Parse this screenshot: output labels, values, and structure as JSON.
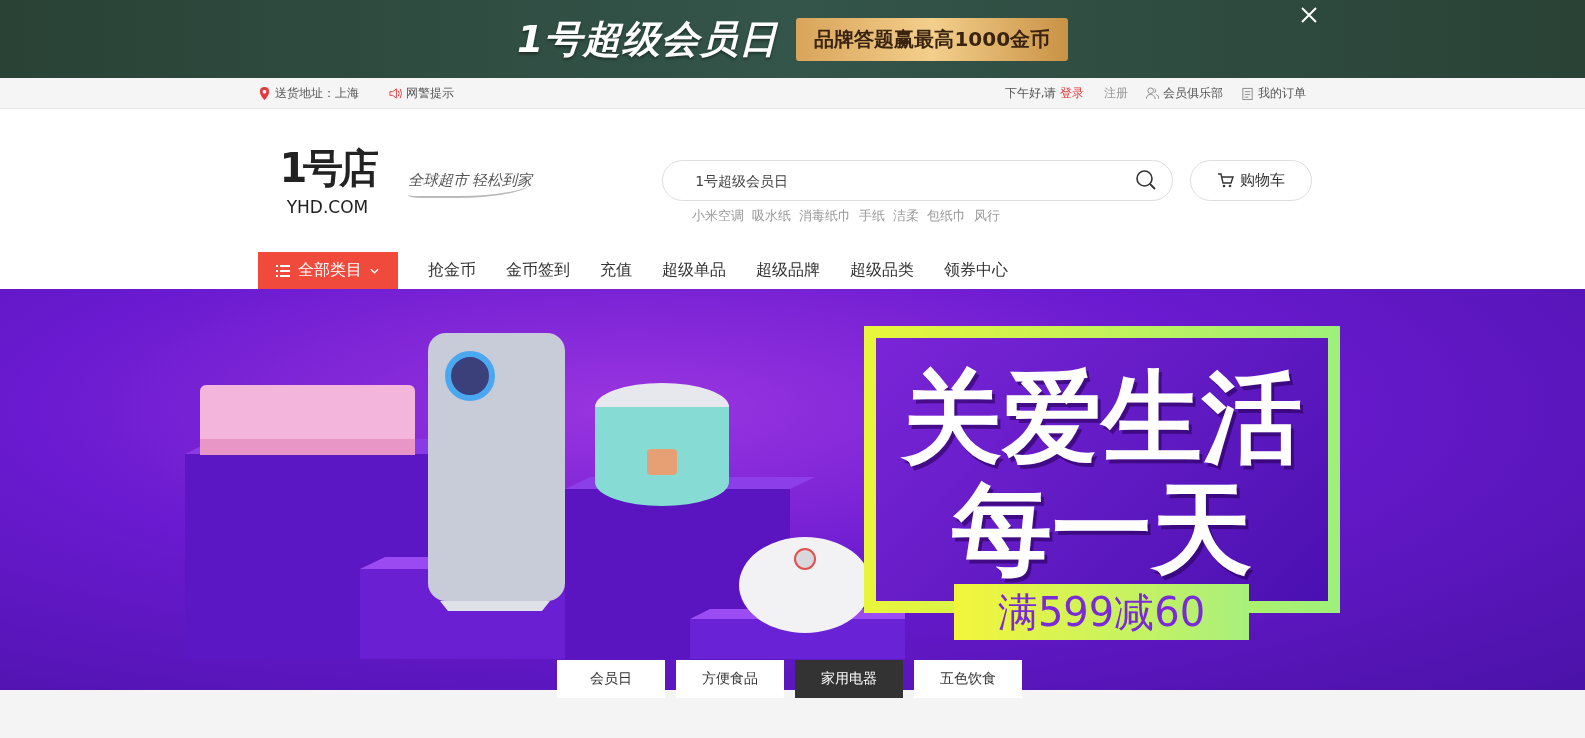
{
  "promo_banner": {
    "title": "1号超级会员日",
    "tagline": "品牌答题赢最高1000金币"
  },
  "top_bar": {
    "location": "送货地址：上海",
    "alert": "网警提示",
    "greeting": "下午好,请",
    "login": "登录",
    "register": "注册",
    "club": "会员俱乐部",
    "orders": "我的订单"
  },
  "header": {
    "logo": {
      "mark": "1号店",
      "domain": "YHD.COM"
    },
    "slogan": "全球超市 轻松到家",
    "search": {
      "placeholder": "1号超级会员日"
    },
    "hot_words": [
      "小米空调",
      "吸水纸",
      "消毒纸巾",
      "手纸",
      "洁柔",
      "包纸巾",
      "风行"
    ],
    "cart": "购物车"
  },
  "nav": {
    "category_button": "全部类目",
    "links": [
      "抢金币",
      "金币签到",
      "充值",
      "超级单品",
      "超级品牌",
      "超级品类",
      "领券中心"
    ]
  },
  "hero": {
    "headline": [
      "关爱生活",
      "每一天"
    ],
    "offer": "满599减60",
    "tabs": [
      {
        "label": "会员日",
        "selected": false
      },
      {
        "label": "方便食品",
        "selected": false
      },
      {
        "label": "家用电器",
        "selected": true
      },
      {
        "label": "五色饮食",
        "selected": false
      }
    ]
  }
}
